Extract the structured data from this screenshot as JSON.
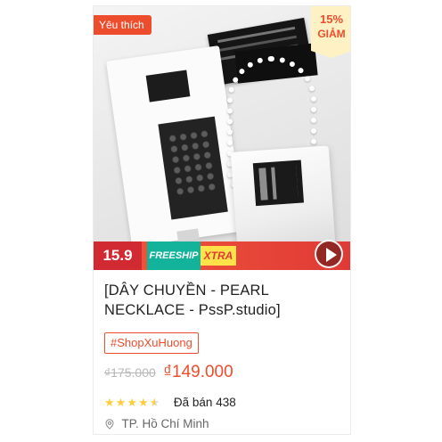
{
  "badges": {
    "favorite": "Yêu thích",
    "discount_percent": "15%",
    "discount_label": "GIẢM"
  },
  "promo": {
    "number": "15.9",
    "freeship": "FREESHIP",
    "xtra": "XTRA"
  },
  "product": {
    "title": "[DÂY CHUYỀN - PEARL NECKLACE - PssP.studio]",
    "hashtag": "#ShopXuHuong",
    "old_price": "₫175.000",
    "new_price": "₫149.000",
    "rating_stars": 4.5,
    "sold": "Đã bán 438",
    "location": "TP. Hồ Chí Minh"
  },
  "icons": {
    "play": "play-icon",
    "location": "map-pin-icon",
    "star": "star-icon"
  },
  "colors": {
    "brand": "#ee4d2d",
    "freeship": "#12b39a",
    "xtra": "#ffe14a",
    "star": "#ffce3d",
    "discount_bg": "#fef1c4"
  }
}
